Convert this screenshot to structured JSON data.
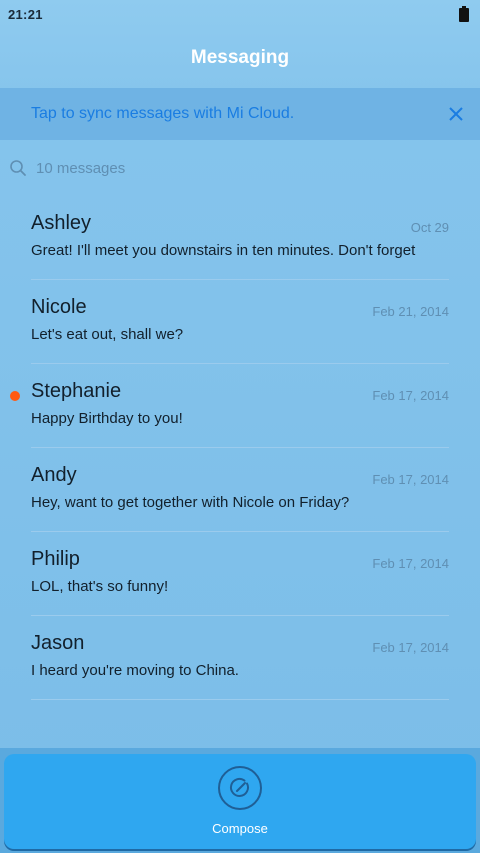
{
  "status_bar": {
    "time": "21:21",
    "battery_icon": "battery-full-icon"
  },
  "header": {
    "title": "Messaging"
  },
  "sync_banner": {
    "text": "Tap to sync messages with Mi Cloud.",
    "close_icon": "close-icon",
    "text_color": "#1a7de2"
  },
  "search": {
    "icon": "search-icon",
    "text": "10 messages"
  },
  "messages": [
    {
      "name": "Ashley",
      "date": "Oct 29",
      "preview": "Great! I'll meet you downstairs in ten minutes. Don't forget",
      "unread": false
    },
    {
      "name": "Nicole",
      "date": "Feb 21, 2014",
      "preview": "Let's eat out, shall we?",
      "unread": false
    },
    {
      "name": "Stephanie",
      "date": "Feb 17, 2014",
      "preview": "Happy Birthday to you!",
      "unread": true
    },
    {
      "name": "Andy",
      "date": "Feb 17, 2014",
      "preview": "Hey, want to get together with Nicole on Friday?",
      "unread": false
    },
    {
      "name": "Philip",
      "date": "Feb 17, 2014",
      "preview": "LOL, that's so funny!",
      "unread": false
    },
    {
      "name": "Jason",
      "date": "Feb 17, 2014",
      "preview": "I heard you're moving to China.",
      "unread": false
    }
  ],
  "compose": {
    "label": "Compose",
    "icon": "compose-icon"
  },
  "colors": {
    "accent": "#2fa7f0",
    "unread_dot": "#ff5a13",
    "banner_bg": "#6fb3e4"
  }
}
